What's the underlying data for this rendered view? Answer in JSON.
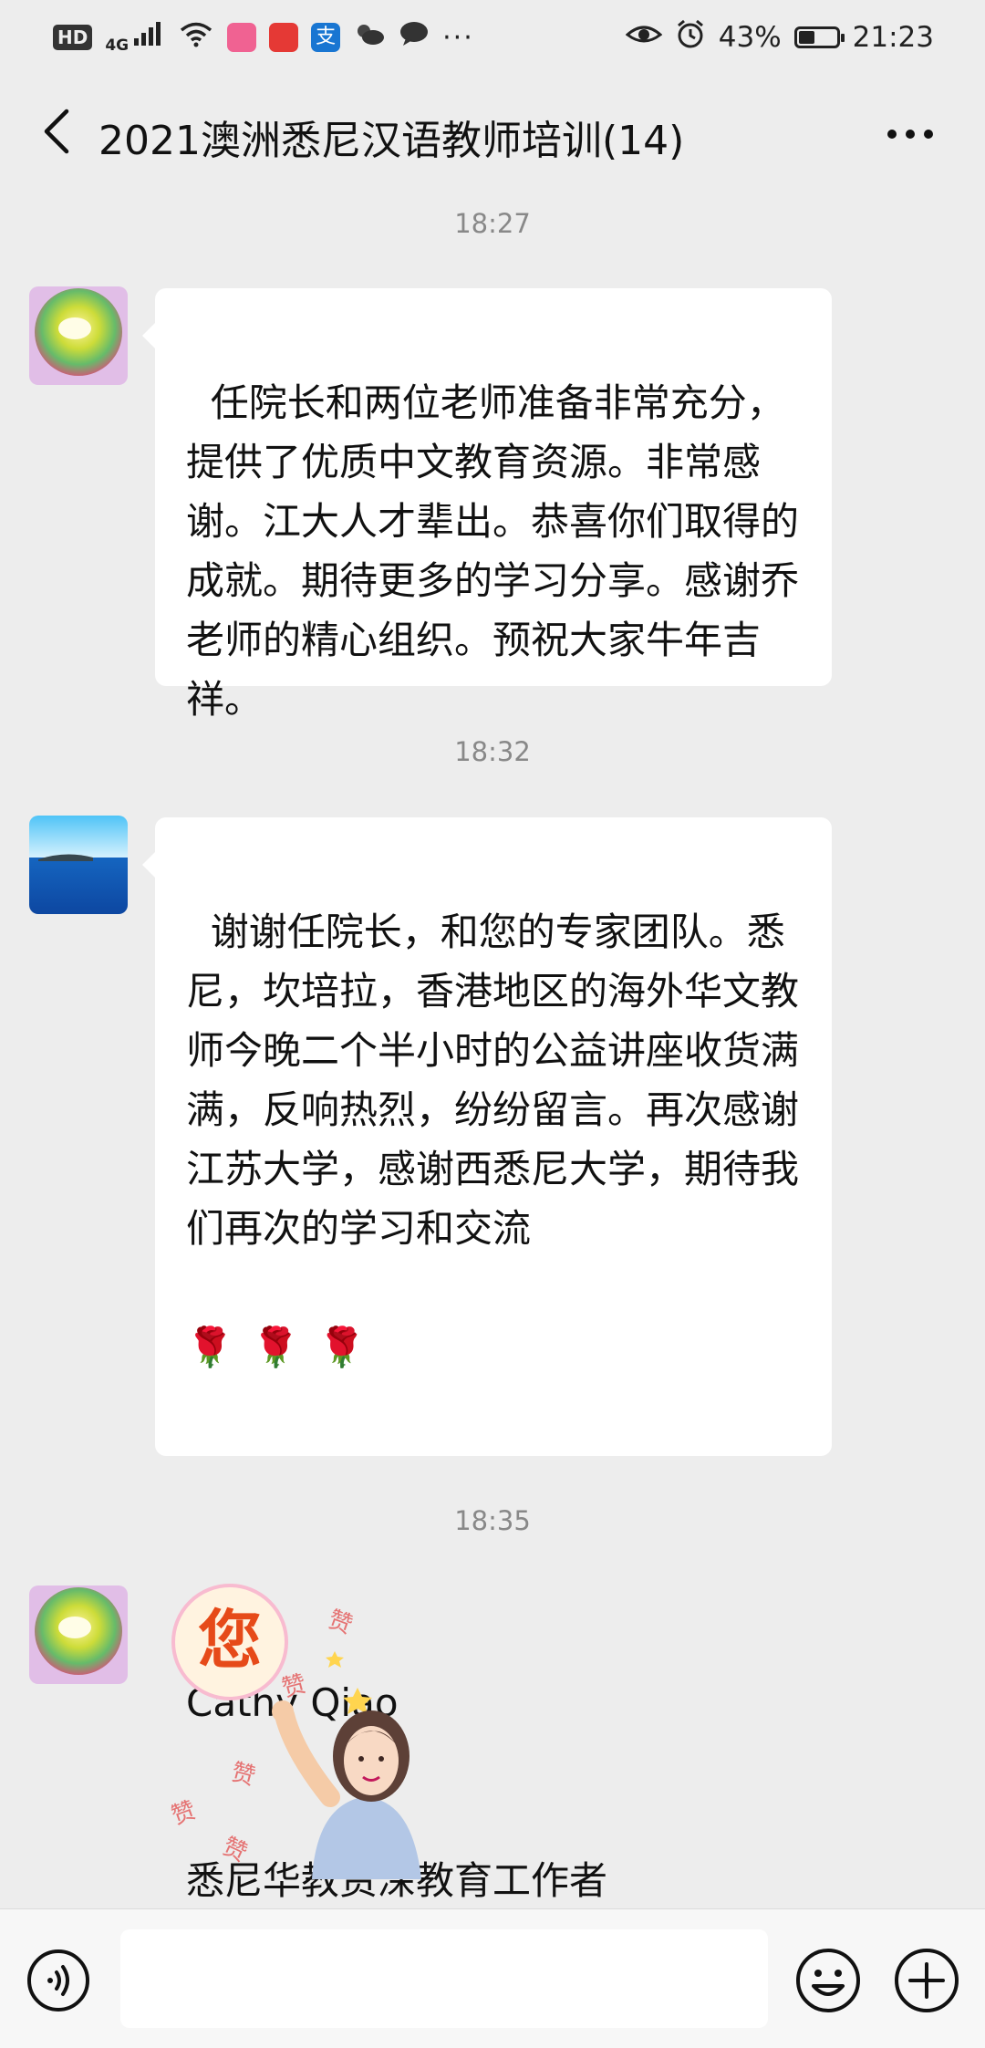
{
  "status_bar": {
    "hd": "HD",
    "network": "4G",
    "battery_percent": "43%",
    "battery_level": 0.43,
    "time": "21:23",
    "more": "···",
    "icons": [
      "signal-icon",
      "wifi-icon",
      "app-notification-icon",
      "weather-icon",
      "message-icon",
      "eye-comfort-icon",
      "alarm-icon",
      "battery-icon"
    ]
  },
  "nav": {
    "title": "2021澳洲悉尼汉语教师培训(14)",
    "back_icon": "back-arrow-icon",
    "more_icon": "more-dots-icon"
  },
  "messages": [
    {
      "timestamp": "18:27",
      "sender_avatar": "rose-avatar",
      "type": "text",
      "text": "任院长和两位老师准备非常充分，提供了优质中文教育资源。非常感谢。江大人才辈出。恭喜你们取得的成就。期待更多的学习分享。感谢乔老师的精心组织。预祝大家牛年吉祥。"
    },
    {
      "timestamp": "18:32",
      "sender_avatar": "ocean-avatar",
      "type": "text",
      "text": "谢谢任院长，和您的专家团队。悉尼，坎培拉，香港地区的海外华文教师今晚二个半小时的公益讲座收货满满，反响热烈，纷纷留言。再次感谢江苏大学，感谢西悉尼大学，期待我们再次的学习和交流",
      "emoji_line": "🌹🌹🌹",
      "signature_name": "Cathy Qiao",
      "signature_title": "悉尼华教资深教育工作者"
    },
    {
      "timestamp": "18:35",
      "sender_avatar": "rose-avatar",
      "type": "sticker",
      "sticker_text": "您",
      "sticker_sub_text": "赞"
    }
  ],
  "input_bar": {
    "placeholder": "",
    "voice_icon": "voice-icon",
    "emoji_icon": "emoji-icon",
    "add_icon": "add-icon"
  }
}
